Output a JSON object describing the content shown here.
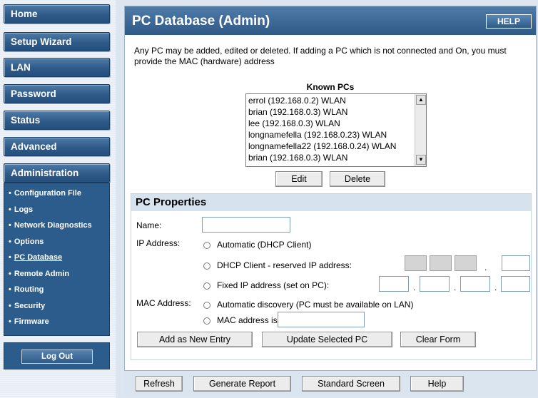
{
  "sidebar": {
    "nav": [
      "Home",
      "Setup Wizard",
      "LAN",
      "Password",
      "Status",
      "Advanced",
      "Administration"
    ],
    "submenu": [
      "Configuration File",
      "Logs",
      "Network Diagnostics",
      "Options",
      "PC Database",
      "Remote Admin",
      "Routing",
      "Security",
      "Firmware"
    ],
    "active_submenu": "PC Database",
    "logout_label": "Log Out"
  },
  "main": {
    "title": "PC Database (Admin)",
    "help_label": "HELP",
    "intro": "Any PC may be added, edited or deleted. If adding a PC which is not connected and On, you must provide the MAC (hardware) address",
    "known_pcs_title": "Known PCs",
    "known_pcs": [
      "errol (192.168.0.2) WLAN",
      "brian (192.168.0.3) WLAN",
      "lee (192.168.0.3) WLAN",
      "longnamefella (192.168.0.23) WLAN",
      "longnamefella22 (192.168.0.24) WLAN",
      "brian (192.168.0.3) WLAN"
    ],
    "edit_label": "Edit",
    "delete_label": "Delete"
  },
  "props": {
    "title": "PC Properties",
    "name_label": "Name:",
    "name_value": "",
    "ip_label": "IP Address:",
    "ip_options": [
      "Automatic (DHCP Client)",
      "DHCP Client - reserved IP address:",
      "Fixed IP address (set on PC):"
    ],
    "mac_label": "MAC Address:",
    "mac_options": [
      "Automatic discovery (PC must be available on LAN)",
      "MAC address is"
    ],
    "mac_value": "",
    "add_label": "Add as New Entry",
    "update_label": "Update Selected PC",
    "clear_label": "Clear Form"
  },
  "bottom": {
    "refresh": "Refresh",
    "report": "Generate Report",
    "standard": "Standard Screen",
    "help": "Help"
  },
  "colors": {
    "nav_blue": "#2f5a88",
    "panel_head": "#d6e2ee"
  }
}
